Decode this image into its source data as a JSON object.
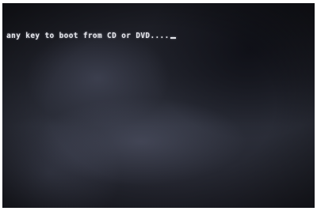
{
  "boot_screen": {
    "message": "ss any key to boot from CD or DVD....",
    "cursor_glyph": "_",
    "text_color": "#e6e7ec",
    "background_color": "#22242d"
  }
}
